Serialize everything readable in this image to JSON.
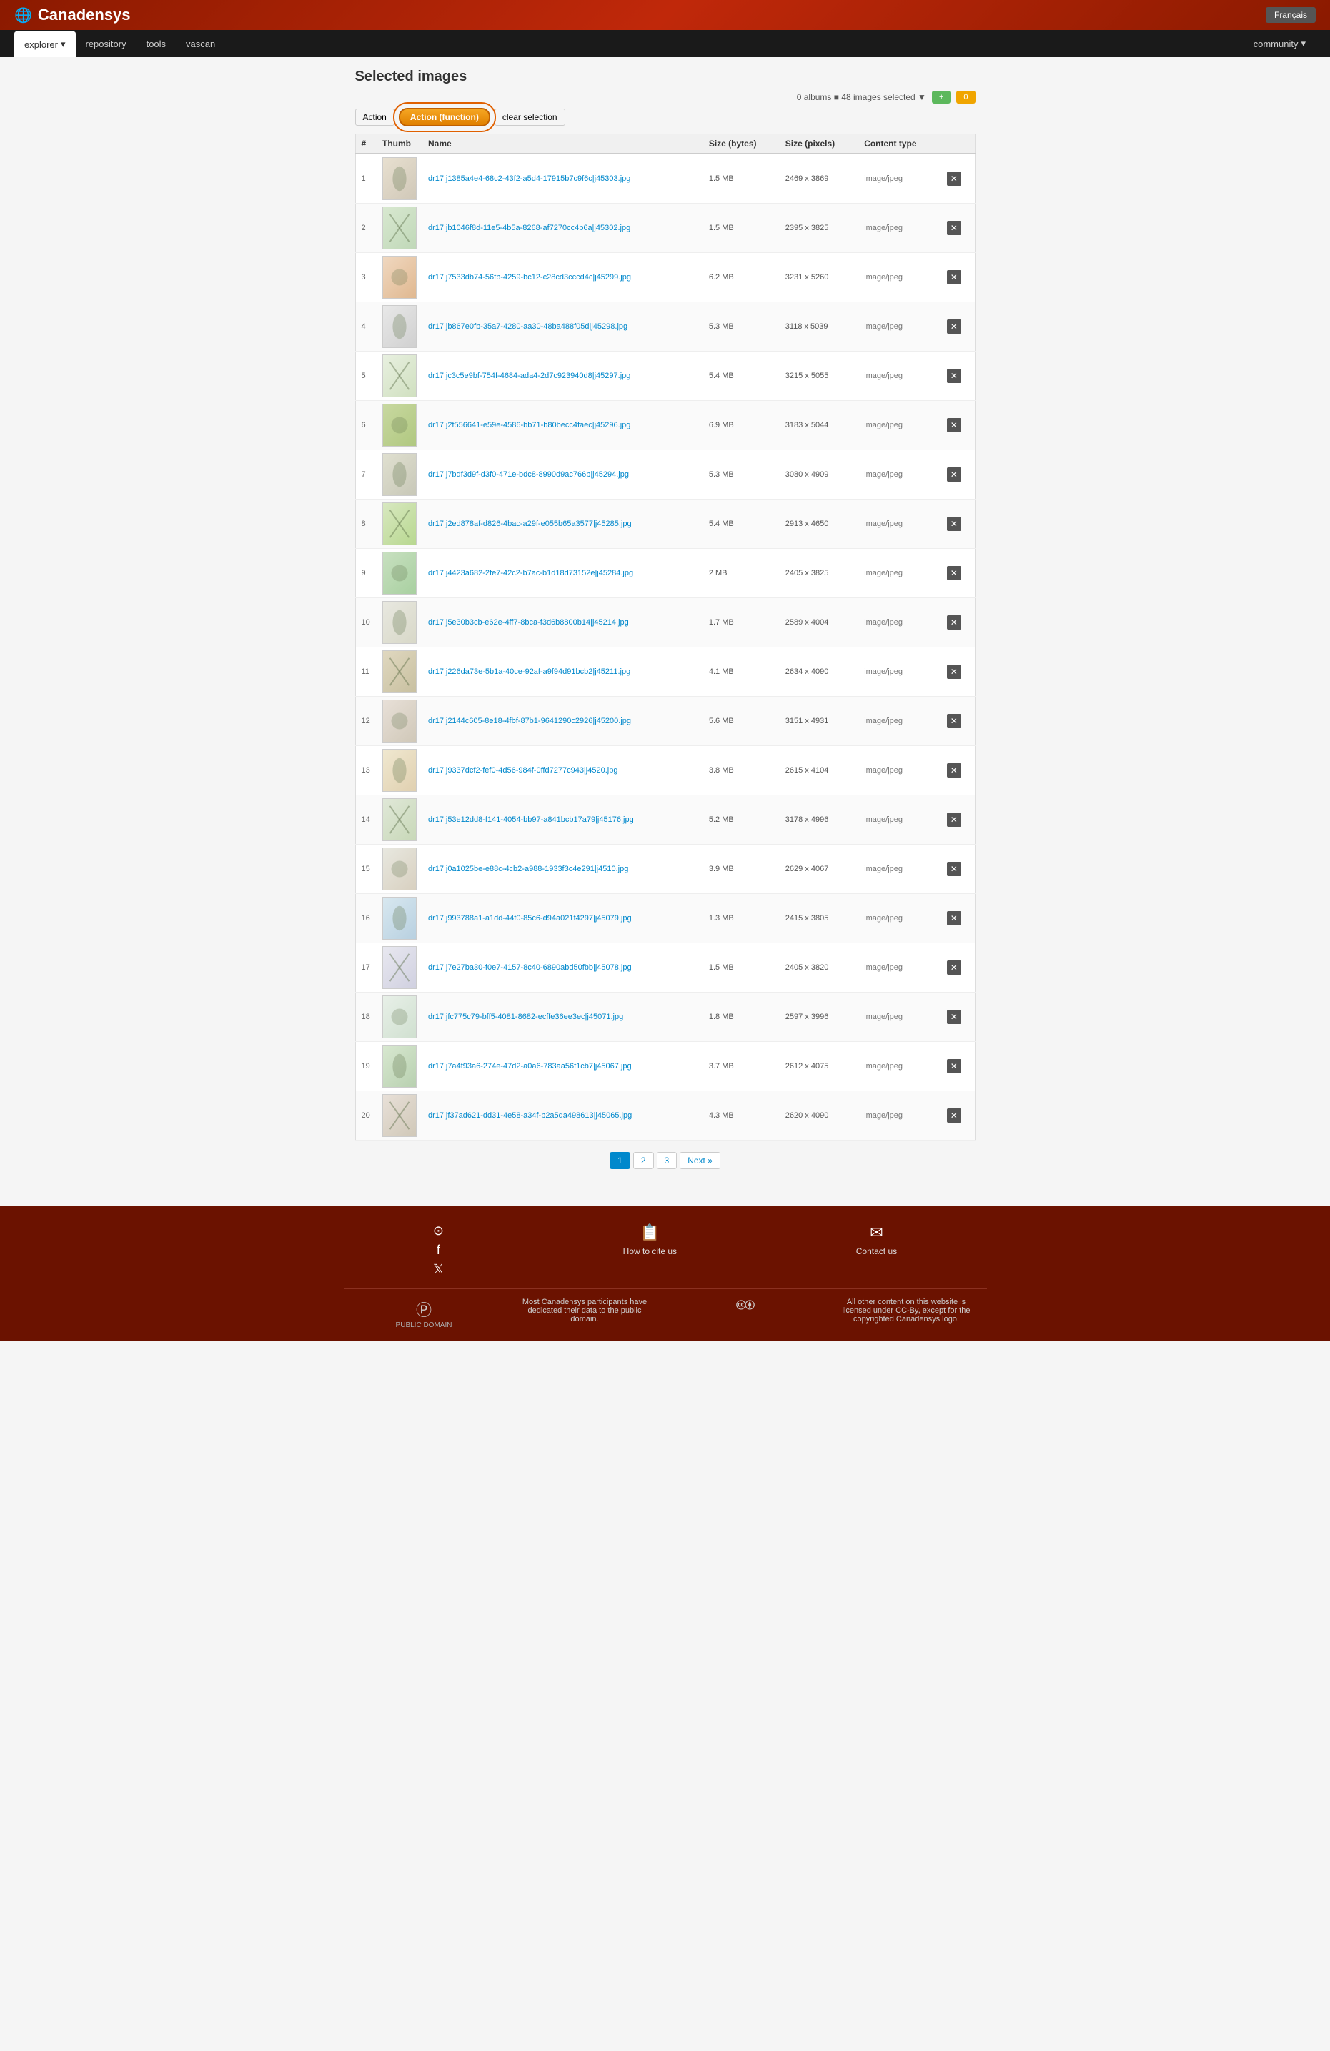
{
  "site": {
    "name": "Canadensys",
    "lang_btn": "Français"
  },
  "nav": {
    "left": [
      {
        "label": "explorer",
        "active": true,
        "dropdown": true
      },
      {
        "label": "repository",
        "active": false
      },
      {
        "label": "tools",
        "active": false
      },
      {
        "label": "vascan",
        "active": false
      }
    ],
    "right": [
      {
        "label": "community",
        "dropdown": true
      }
    ]
  },
  "page": {
    "title": "Selected images",
    "selection_info": "0 albums ■ 48 images selected ▼",
    "btn_plus": "+",
    "btn_minus": "0"
  },
  "toolbar": {
    "action_label": "Action",
    "action_btn_label": "Action (function)",
    "clear_label": "clear selection"
  },
  "table": {
    "headers": [
      "#",
      "Thumb",
      "Name",
      "Size (bytes)",
      "Size (pixels)",
      "Content type",
      ""
    ],
    "rows": [
      {
        "num": "1",
        "name": "dr17|j1385a4e4-68c2-43f2-a5d4-17915b7c9f6c|j45303.jpg",
        "size": "1.5 MB",
        "pixels": "2469 x 3869",
        "type": "image/jpeg"
      },
      {
        "num": "2",
        "name": "dr17|jb1046f8d-11e5-4b5a-8268-af7270cc4b6a|j45302.jpg",
        "size": "1.5 MB",
        "pixels": "2395 x 3825",
        "type": "image/jpeg"
      },
      {
        "num": "3",
        "name": "dr17|j7533db74-56fb-4259-bc12-c28cd3cccd4c|j45299.jpg",
        "size": "6.2 MB",
        "pixels": "3231 x 5260",
        "type": "image/jpeg"
      },
      {
        "num": "4",
        "name": "dr17|jb867e0fb-35a7-4280-aa30-48ba488f05d|j45298.jpg",
        "size": "5.3 MB",
        "pixels": "3118 x 5039",
        "type": "image/jpeg"
      },
      {
        "num": "5",
        "name": "dr17|jc3c5e9bf-754f-4684-ada4-2d7c923940d8|j45297.jpg",
        "size": "5.4 MB",
        "pixels": "3215 x 5055",
        "type": "image/jpeg"
      },
      {
        "num": "6",
        "name": "dr17|j2f556641-e59e-4586-bb71-b80becc4faec|j45296.jpg",
        "size": "6.9 MB",
        "pixels": "3183 x 5044",
        "type": "image/jpeg"
      },
      {
        "num": "7",
        "name": "dr17|j7bdf3d9f-d3f0-471e-bdc8-8990d9ac766b|j45294.jpg",
        "size": "5.3 MB",
        "pixels": "3080 x 4909",
        "type": "image/jpeg"
      },
      {
        "num": "8",
        "name": "dr17|j2ed878af-d826-4bac-a29f-e055b65a3577|j45285.jpg",
        "size": "5.4 MB",
        "pixels": "2913 x 4650",
        "type": "image/jpeg"
      },
      {
        "num": "9",
        "name": "dr17|j4423a682-2fe7-42c2-b7ac-b1d18d73152e|j45284.jpg",
        "size": "2 MB",
        "pixels": "2405 x 3825",
        "type": "image/jpeg"
      },
      {
        "num": "10",
        "name": "dr17|j5e30b3cb-e62e-4ff7-8bca-f3d6b8800b14|j45214.jpg",
        "size": "1.7 MB",
        "pixels": "2589 x 4004",
        "type": "image/jpeg"
      },
      {
        "num": "11",
        "name": "dr17|j226da73e-5b1a-40ce-92af-a9f94d91bcb2|j45211.jpg",
        "size": "4.1 MB",
        "pixels": "2634 x 4090",
        "type": "image/jpeg"
      },
      {
        "num": "12",
        "name": "dr17|j2144c605-8e18-4fbf-87b1-9641290c2926|j45200.jpg",
        "size": "5.6 MB",
        "pixels": "3151 x 4931",
        "type": "image/jpeg"
      },
      {
        "num": "13",
        "name": "dr17|j9337dcf2-fef0-4d56-984f-0ffd7277c943|j4520.jpg",
        "size": "3.8 MB",
        "pixels": "2615 x 4104",
        "type": "image/jpeg"
      },
      {
        "num": "14",
        "name": "dr17|j53e12dd8-f141-4054-bb97-a841bcb17a79|j45176.jpg",
        "size": "5.2 MB",
        "pixels": "3178 x 4996",
        "type": "image/jpeg"
      },
      {
        "num": "15",
        "name": "dr17|j0a1025be-e88c-4cb2-a988-1933f3c4e291|j4510.jpg",
        "size": "3.9 MB",
        "pixels": "2629 x 4067",
        "type": "image/jpeg"
      },
      {
        "num": "16",
        "name": "dr17|j993788a1-a1dd-44f0-85c6-d94a021f4297|j45079.jpg",
        "size": "1.3 MB",
        "pixels": "2415 x 3805",
        "type": "image/jpeg"
      },
      {
        "num": "17",
        "name": "dr17|j7e27ba30-f0e7-4157-8c40-6890abd50fbb|j45078.jpg",
        "size": "1.5 MB",
        "pixels": "2405 x 3820",
        "type": "image/jpeg"
      },
      {
        "num": "18",
        "name": "dr17|jfc775c79-bff5-4081-8682-ecffe36ee3ec|j45071.jpg",
        "size": "1.8 MB",
        "pixels": "2597 x 3996",
        "type": "image/jpeg"
      },
      {
        "num": "19",
        "name": "dr17|j7a4f93a6-274e-47d2-a0a6-783aa56f1cb7|j45067.jpg",
        "size": "3.7 MB",
        "pixels": "2612 x 4075",
        "type": "image/jpeg"
      },
      {
        "num": "20",
        "name": "dr17|jf37ad621-dd31-4e58-a34f-b2a5da498613|j45065.jpg",
        "size": "4.3 MB",
        "pixels": "2620 x 4090",
        "type": "image/jpeg"
      }
    ]
  },
  "pagination": {
    "pages": [
      "1",
      "2",
      "3"
    ],
    "next": "Next »",
    "current": "1"
  },
  "footer": {
    "social_icons": [
      "github",
      "facebook",
      "twitter"
    ],
    "cite_label": "How to cite us",
    "contact_label": "Contact us",
    "pd_text": "Most Canadensys participants have dedicated their data to the public domain.",
    "cc_text": "All other content on this website is licensed under CC-By, except for the copyrighted Canadensys logo."
  }
}
